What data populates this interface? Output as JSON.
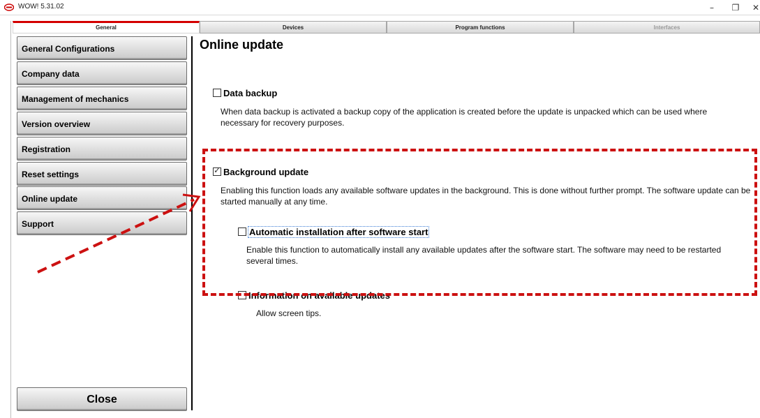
{
  "window": {
    "title": "WOW! 5.31.02",
    "controls": {
      "minimize": "–",
      "maximize": "❐",
      "close": "✕"
    }
  },
  "tabs": [
    {
      "label": "General",
      "state": "active"
    },
    {
      "label": "Devices",
      "state": "normal"
    },
    {
      "label": "Program functions",
      "state": "normal"
    },
    {
      "label": "Interfaces",
      "state": "disabled"
    }
  ],
  "sidebar": {
    "items": [
      {
        "label": "General Configurations"
      },
      {
        "label": "Company data"
      },
      {
        "label": "Management of mechanics"
      },
      {
        "label": "Version overview"
      },
      {
        "label": "Registration"
      },
      {
        "label": "Reset settings"
      },
      {
        "label": "Online update"
      },
      {
        "label": "Support"
      }
    ],
    "close_label": "Close"
  },
  "content": {
    "title": "Online update",
    "options": {
      "data_backup": {
        "label": "Data backup",
        "checked": false,
        "description": "When data backup is activated a backup copy of the application is created before the update is unpacked which can be used where necessary for recovery purposes."
      },
      "background_update": {
        "label": "Background update",
        "checked": true,
        "description": "Enabling this function loads any available software updates in the background. This is done without further prompt. The software update can be started manually at any time."
      },
      "auto_install": {
        "label": "Automatic installation after software start",
        "checked": false,
        "description": "Enable this function to automatically install any available updates after the software start. The software may need to be restarted several times."
      },
      "info_updates": {
        "label": "Information on available updates",
        "checked": false,
        "description": "Allow screen tips."
      }
    }
  },
  "colors": {
    "accent": "#d40000",
    "annotation": "#cc1111"
  }
}
